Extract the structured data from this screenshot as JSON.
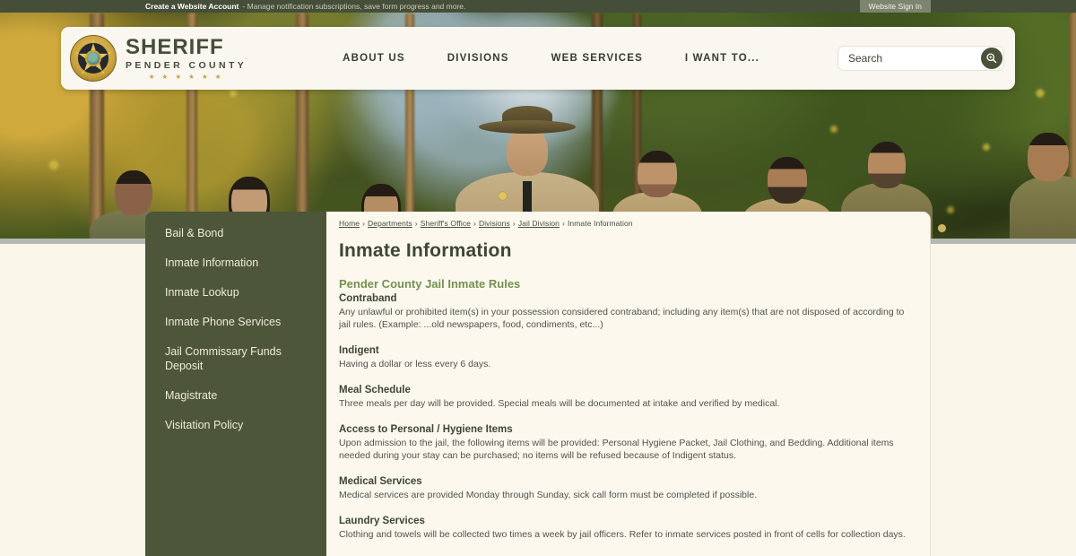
{
  "topbar": {
    "account_link": "Create a Website Account",
    "account_desc": "- Manage notification subscriptions, save form progress and more.",
    "signin_label": "Website Sign In"
  },
  "header": {
    "logo": {
      "title": "SHERIFF",
      "subtitle": "PENDER COUNTY",
      "stars": "★ ★ ★ ★ ★ ★",
      "badge_icon": "sheriff-star-badge-icon"
    },
    "nav": [
      {
        "label": "ABOUT US"
      },
      {
        "label": "DIVISIONS"
      },
      {
        "label": "WEB SERVICES"
      },
      {
        "label": "I WANT TO..."
      }
    ],
    "search": {
      "placeholder": "Search",
      "icon": "search-zoom-icon"
    }
  },
  "sidebar": {
    "items": [
      {
        "label": "Bail & Bond"
      },
      {
        "label": "Inmate Information"
      },
      {
        "label": "Inmate Lookup"
      },
      {
        "label": "Inmate Phone Services"
      },
      {
        "label": "Jail Commissary Funds Deposit"
      },
      {
        "label": "Magistrate"
      },
      {
        "label": "Visitation Policy"
      }
    ]
  },
  "breadcrumb": {
    "separator": "›",
    "links": [
      "Home",
      "Departments",
      "Sheriff's Office",
      "Divisions",
      "Jail Division"
    ],
    "current": "Inmate Information"
  },
  "content": {
    "page_title": "Inmate Information",
    "section_title": "Pender County Jail Inmate Rules",
    "rules": [
      {
        "heading": "Contraband",
        "body": "Any unlawful or prohibited item(s) in your possession considered contraband; including any item(s) that are not disposed of according to jail rules. (Example: ...old newspapers, food, condiments, etc...)"
      },
      {
        "heading": "Indigent",
        "body": "Having a dollar or less every 6 days."
      },
      {
        "heading": "Meal Schedule",
        "body": "Three meals per day will be provided. Special meals will be documented at intake and verified by medical."
      },
      {
        "heading": "Access to Personal / Hygiene Items",
        "body": "Upon admission to the jail, the following items will be provided: Personal Hygiene Packet, Jail Clothing, and Bedding. Additional items needed during your stay can be purchased; no items will be refused because of Indigent status."
      },
      {
        "heading": "Medical Services",
        "body": "Medical services are provided Monday through Sunday, sick call form must be completed if possible."
      },
      {
        "heading": "Laundry Services",
        "body": "Clothing and towels will be collected two times a week by jail officers. Refer to inmate services posted in front of cells for collection days."
      }
    ]
  },
  "colors": {
    "olive_topbar": "#454e38",
    "olive_sidebar": "#4d5639",
    "cream_panel": "#fcf8ee",
    "accent_green": "#74914e",
    "badge_gold": "#c9a24a"
  }
}
